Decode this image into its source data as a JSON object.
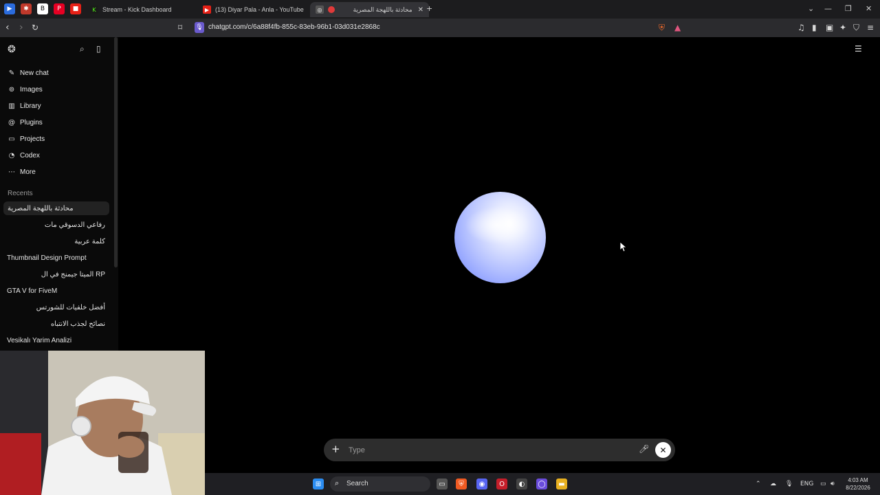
{
  "browser": {
    "tabs": [
      {
        "title": "Stream - Kick Dashboard"
      },
      {
        "title": "(13) Diyar Pala - Anla - YouTube"
      },
      {
        "title": "محادثة باللهجة المصرية"
      }
    ],
    "url": "chatgpt.com/c/6a88f4fb-855c-83eb-96b1-03d031e2868c"
  },
  "sidebar": {
    "nav": [
      {
        "label": "New chat",
        "icon": "edit-icon"
      },
      {
        "label": "Images",
        "icon": "images-icon"
      },
      {
        "label": "Library",
        "icon": "library-icon"
      },
      {
        "label": "Plugins",
        "icon": "plugins-icon"
      },
      {
        "label": "Projects",
        "icon": "folder-icon"
      },
      {
        "label": "Codex",
        "icon": "codex-icon"
      },
      {
        "label": "More",
        "icon": "more-icon"
      }
    ],
    "recents_title": "Recents",
    "chats": [
      "محادثة باللهجة المصرية",
      "رفاعي الدسوقي مات",
      "كلمة عربية",
      "Thumbnail Design Prompt",
      "الميتا جيمنج في ال RP",
      "GTA V for FiveM",
      "أفضل خلفيات للشورتس",
      "نصائح لجذب الانتباه",
      "Vesikalı Yarim Analizi"
    ]
  },
  "composer": {
    "placeholder": "Type"
  },
  "taskbar": {
    "search_label": "Search",
    "language": "ENG",
    "time": "4:03 AM",
    "date": "8/22/2026"
  },
  "colors": {
    "background": "#000000",
    "sidebar": "#0a0a0a",
    "composer": "#2d2d2d",
    "orb": "#8ea0ff"
  }
}
